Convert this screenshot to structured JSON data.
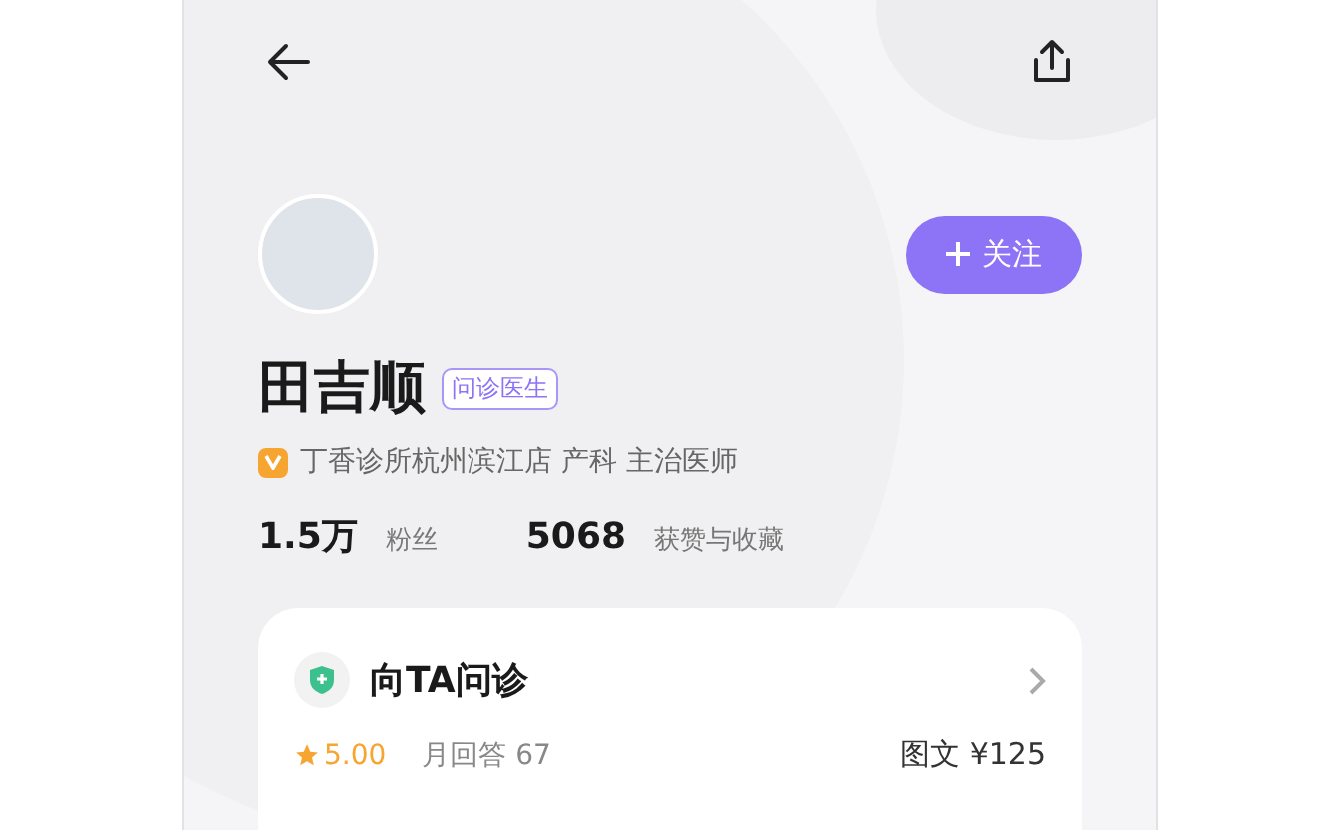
{
  "doctor": {
    "name": "田吉顺",
    "badge": "问诊医生",
    "verified": true,
    "affiliation": "丁香诊所杭州滨江店 产科 主治医师"
  },
  "follow_button": {
    "label": "关注"
  },
  "stats": [
    {
      "value": "1.5万",
      "label": "粉丝"
    },
    {
      "value": "5068",
      "label": "获赞与收藏"
    }
  ],
  "consult_card": {
    "title": "向TA问诊",
    "rating": "5.00",
    "monthly_answers": "月回答 67",
    "price": "图文 ¥125"
  }
}
